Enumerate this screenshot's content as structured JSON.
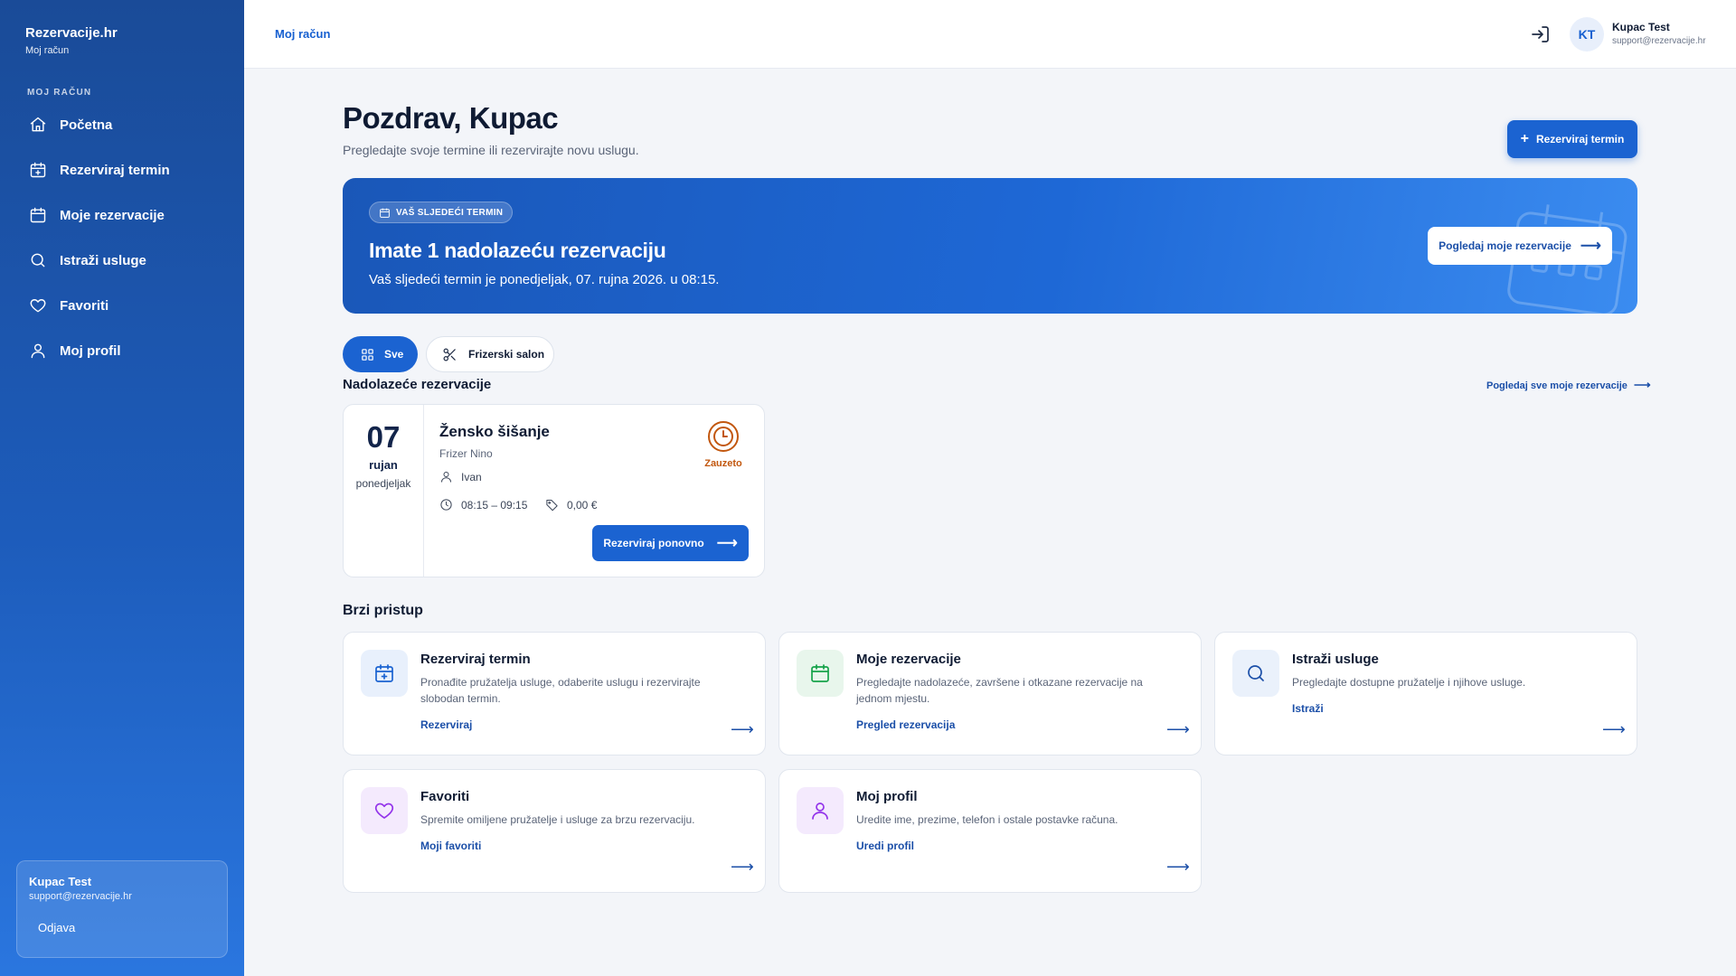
{
  "sidebar": {
    "brand_title": "Rezervacije.hr",
    "brand_sub": "Moj račun",
    "section_label": "MOJ RAČUN",
    "items": [
      {
        "label": "Početna",
        "icon": "home-icon"
      },
      {
        "label": "Rezerviraj termin",
        "icon": "calendar-plus-icon"
      },
      {
        "label": "Moje rezervacije",
        "icon": "calendar-icon"
      },
      {
        "label": "Istraži usluge",
        "icon": "search-icon"
      },
      {
        "label": "Favoriti",
        "icon": "heart-icon"
      },
      {
        "label": "Moj profil",
        "icon": "user-icon"
      }
    ],
    "user": {
      "name": "Kupac Test",
      "email": "support@rezervacije.hr",
      "logout": "Odjava"
    }
  },
  "header": {
    "breadcrumb": "Moj račun",
    "avatar_initials": "KT",
    "user_name": "Kupac Test",
    "user_email": "support@rezervacije.hr"
  },
  "main": {
    "greeting": "Pozdrav, Kupac",
    "subtitle": "Pregledajte svoje termine ili rezervirajte novu uslugu.",
    "primary_button": "Rezerviraj termin",
    "hero": {
      "badge": "VAŠ SLJEDEĆI TERMIN",
      "title": "Imate 1 nadolazeću rezervaciju",
      "text": "Vaš sljedeći termin je ponedjeljak, 07. rujna 2026. u 08:15.",
      "button": "Pogledaj moje rezervacije"
    },
    "filters": [
      {
        "label": "Sve",
        "active": true
      },
      {
        "label": "Frizerski salon",
        "active": false
      }
    ],
    "upcoming": {
      "title": "Nadolazeće rezervacije",
      "link": "Pogledaj sve moje rezervacije",
      "booking": {
        "day": "07",
        "month": "rujan",
        "weekday": "ponedjeljak",
        "service": "Žensko šišanje",
        "provider": "Frizer Nino",
        "employee": "Ivan",
        "time": "08:15 – 09:15",
        "price": "0,00 €",
        "status": "Zauzeto",
        "button": "Rezerviraj ponovno"
      }
    },
    "quick_access": {
      "title": "Brzi pristup",
      "cards": [
        {
          "title": "Rezerviraj termin",
          "desc": "Pronađite pružatelja usluge, odaberite uslugu i rezervirajte slobodan termin.",
          "link": "Rezerviraj",
          "icon": "calendar-plus-icon"
        },
        {
          "title": "Moje rezervacije",
          "desc": "Pregledajte nadolazeće, završene i otkazane rezervacije na jednom mjestu.",
          "link": "Pregled rezervacija",
          "icon": "calendar-icon"
        },
        {
          "title": "Istraži usluge",
          "desc": "Pregledajte dostupne pružatelje i njihove usluge.",
          "link": "Istraži",
          "icon": "search-icon"
        },
        {
          "title": "Favoriti",
          "desc": "Spremite omiljene pružatelje i usluge za brzu rezervaciju.",
          "link": "Moji favoriti",
          "icon": "heart-icon"
        },
        {
          "title": "Moj profil",
          "desc": "Uredite ime, prezime, telefon i ostale postavke računa.",
          "link": "Uredi profil",
          "icon": "user-icon"
        }
      ]
    }
  },
  "colors": {
    "primary": "#1b63d1",
    "sidebar_top": "#1a4b98",
    "status_busy": "#c2570e",
    "icon_blue": "#1b63d1",
    "icon_green": "#16a34a",
    "icon_purple": "#9333ea"
  }
}
